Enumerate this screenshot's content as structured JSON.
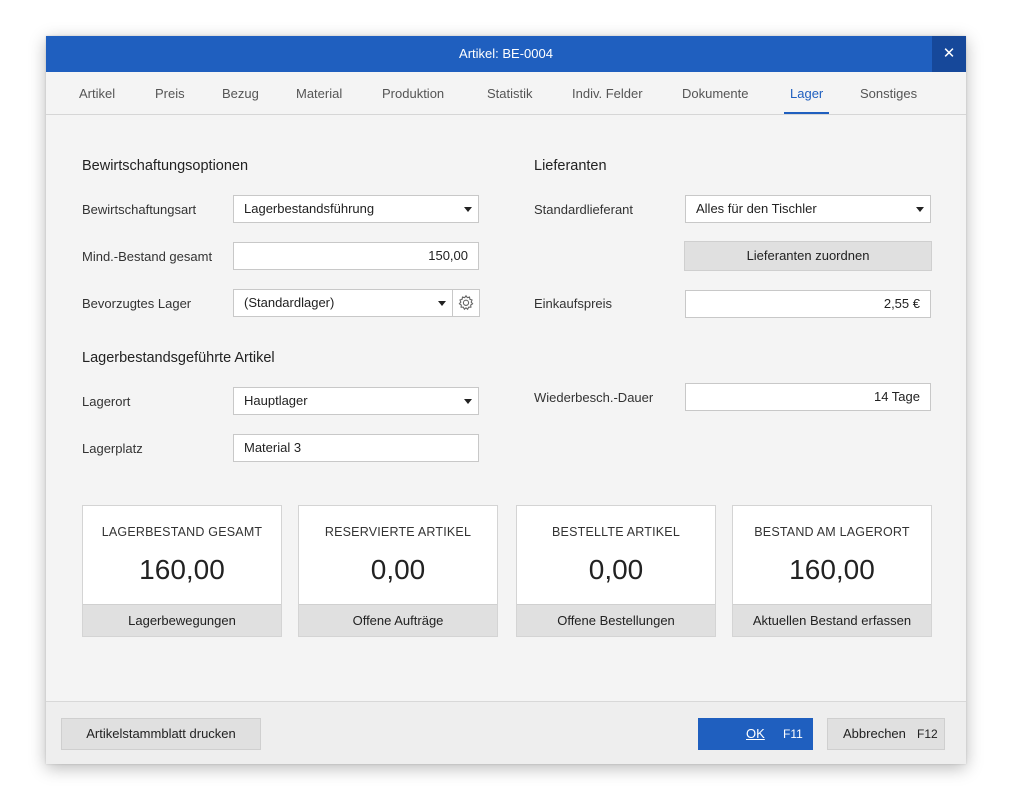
{
  "window": {
    "title": "Artikel: BE-0004",
    "close_glyph": "✕"
  },
  "tabs": [
    {
      "label": "Artikel"
    },
    {
      "label": "Preis"
    },
    {
      "label": "Bezug"
    },
    {
      "label": "Material"
    },
    {
      "label": "Produktion"
    },
    {
      "label": "Statistik"
    },
    {
      "label": "Indiv. Felder"
    },
    {
      "label": "Dokumente"
    },
    {
      "label": "Lager",
      "active": true
    },
    {
      "label": "Sonstiges"
    }
  ],
  "bewirtschaftung": {
    "title": "Bewirtschaftungsoptionen",
    "art_label": "Bewirtschaftungsart",
    "art_value": "Lagerbestandsführung",
    "mind_label": "Mind.-Bestand gesamt",
    "mind_value": "150,00",
    "lager_label": "Bevorzugtes Lager",
    "lager_value": "(Standardlager)"
  },
  "lieferanten": {
    "title": "Lieferanten",
    "standard_label": "Standardlieferant",
    "standard_value": "Alles für den Tischler",
    "zuordnen_label": "Lieferanten zuordnen",
    "preis_label": "Einkaufspreis",
    "preis_value": "2,55 €",
    "dauer_label": "Wiederbesch.-Dauer",
    "dauer_value": "14 Tage"
  },
  "lagerartikel": {
    "title": "Lagerbestandsgeführte Artikel",
    "ort_label": "Lagerort",
    "ort_value": "Hauptlager",
    "platz_label": "Lagerplatz",
    "platz_value": "Material 3"
  },
  "cards": [
    {
      "title": "LAGERBESTAND GESAMT",
      "value": "160,00",
      "button": "Lagerbewegungen"
    },
    {
      "title": "RESERVIERTE ARTIKEL",
      "value": "0,00",
      "button": "Offene Aufträge"
    },
    {
      "title": "BESTELLTE ARTIKEL",
      "value": "0,00",
      "button": "Offene Bestellungen"
    },
    {
      "title": "BESTAND AM LAGERORT",
      "value": "160,00",
      "button": "Aktuellen Bestand erfassen"
    }
  ],
  "footer": {
    "print_label": "Artikelstammblatt drucken",
    "ok_label": "OK",
    "ok_key": "F11",
    "cancel_label": "Abbrechen",
    "cancel_key": "F12"
  },
  "colors": {
    "accent": "#1f5fbf",
    "close_bg": "#16489a"
  },
  "icons": {
    "close": "close-icon",
    "dropdown": "chevron-down-icon",
    "settings": "gear-icon"
  }
}
